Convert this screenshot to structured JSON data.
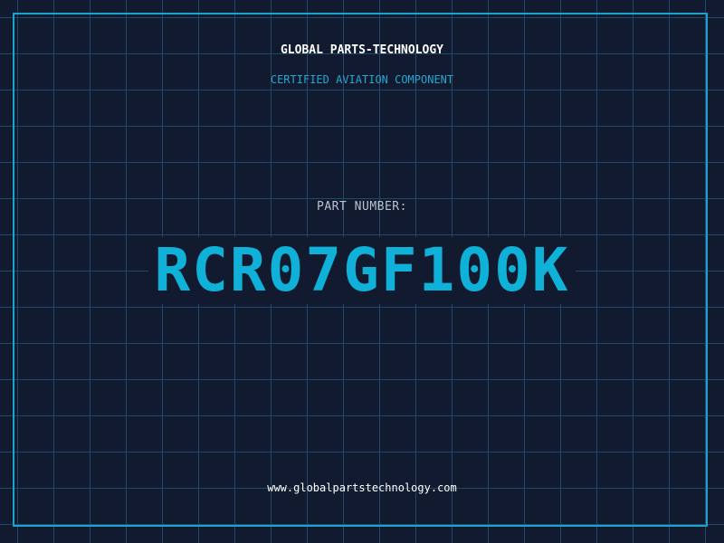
{
  "header": {
    "brand": "GLOBAL PARTS-TECHNOLOGY",
    "subtitle": "CERTIFIED AVIATION COMPONENT"
  },
  "part": {
    "label": "PART NUMBER:",
    "number": "RCR07GF100K"
  },
  "footer": {
    "url": "www.globalpartstechnology.com"
  },
  "colors": {
    "background": "#111a2e",
    "grid": "#1d4a66",
    "accent": "#0fb1d8",
    "frame": "#1fa2c9"
  }
}
